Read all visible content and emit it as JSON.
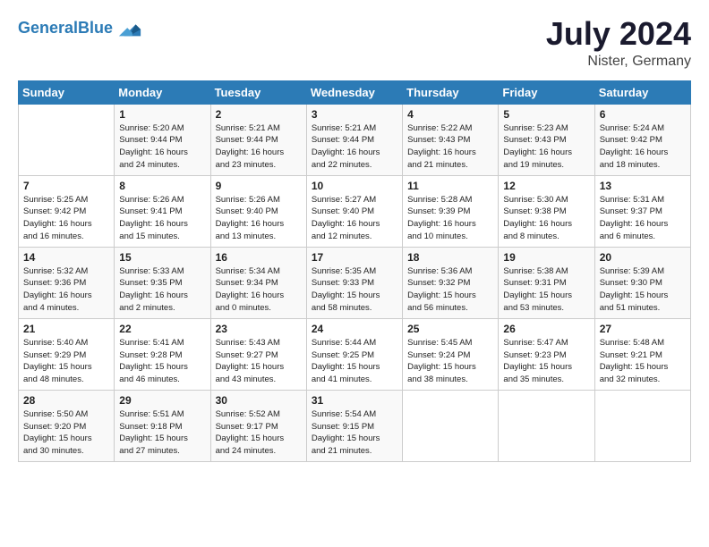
{
  "header": {
    "logo_line1": "General",
    "logo_line2": "Blue",
    "month": "July 2024",
    "location": "Nister, Germany"
  },
  "weekdays": [
    "Sunday",
    "Monday",
    "Tuesday",
    "Wednesday",
    "Thursday",
    "Friday",
    "Saturday"
  ],
  "weeks": [
    [
      {
        "day": "",
        "info": ""
      },
      {
        "day": "1",
        "info": "Sunrise: 5:20 AM\nSunset: 9:44 PM\nDaylight: 16 hours\nand 24 minutes."
      },
      {
        "day": "2",
        "info": "Sunrise: 5:21 AM\nSunset: 9:44 PM\nDaylight: 16 hours\nand 23 minutes."
      },
      {
        "day": "3",
        "info": "Sunrise: 5:21 AM\nSunset: 9:44 PM\nDaylight: 16 hours\nand 22 minutes."
      },
      {
        "day": "4",
        "info": "Sunrise: 5:22 AM\nSunset: 9:43 PM\nDaylight: 16 hours\nand 21 minutes."
      },
      {
        "day": "5",
        "info": "Sunrise: 5:23 AM\nSunset: 9:43 PM\nDaylight: 16 hours\nand 19 minutes."
      },
      {
        "day": "6",
        "info": "Sunrise: 5:24 AM\nSunset: 9:42 PM\nDaylight: 16 hours\nand 18 minutes."
      }
    ],
    [
      {
        "day": "7",
        "info": "Sunrise: 5:25 AM\nSunset: 9:42 PM\nDaylight: 16 hours\nand 16 minutes."
      },
      {
        "day": "8",
        "info": "Sunrise: 5:26 AM\nSunset: 9:41 PM\nDaylight: 16 hours\nand 15 minutes."
      },
      {
        "day": "9",
        "info": "Sunrise: 5:26 AM\nSunset: 9:40 PM\nDaylight: 16 hours\nand 13 minutes."
      },
      {
        "day": "10",
        "info": "Sunrise: 5:27 AM\nSunset: 9:40 PM\nDaylight: 16 hours\nand 12 minutes."
      },
      {
        "day": "11",
        "info": "Sunrise: 5:28 AM\nSunset: 9:39 PM\nDaylight: 16 hours\nand 10 minutes."
      },
      {
        "day": "12",
        "info": "Sunrise: 5:30 AM\nSunset: 9:38 PM\nDaylight: 16 hours\nand 8 minutes."
      },
      {
        "day": "13",
        "info": "Sunrise: 5:31 AM\nSunset: 9:37 PM\nDaylight: 16 hours\nand 6 minutes."
      }
    ],
    [
      {
        "day": "14",
        "info": "Sunrise: 5:32 AM\nSunset: 9:36 PM\nDaylight: 16 hours\nand 4 minutes."
      },
      {
        "day": "15",
        "info": "Sunrise: 5:33 AM\nSunset: 9:35 PM\nDaylight: 16 hours\nand 2 minutes."
      },
      {
        "day": "16",
        "info": "Sunrise: 5:34 AM\nSunset: 9:34 PM\nDaylight: 16 hours\nand 0 minutes."
      },
      {
        "day": "17",
        "info": "Sunrise: 5:35 AM\nSunset: 9:33 PM\nDaylight: 15 hours\nand 58 minutes."
      },
      {
        "day": "18",
        "info": "Sunrise: 5:36 AM\nSunset: 9:32 PM\nDaylight: 15 hours\nand 56 minutes."
      },
      {
        "day": "19",
        "info": "Sunrise: 5:38 AM\nSunset: 9:31 PM\nDaylight: 15 hours\nand 53 minutes."
      },
      {
        "day": "20",
        "info": "Sunrise: 5:39 AM\nSunset: 9:30 PM\nDaylight: 15 hours\nand 51 minutes."
      }
    ],
    [
      {
        "day": "21",
        "info": "Sunrise: 5:40 AM\nSunset: 9:29 PM\nDaylight: 15 hours\nand 48 minutes."
      },
      {
        "day": "22",
        "info": "Sunrise: 5:41 AM\nSunset: 9:28 PM\nDaylight: 15 hours\nand 46 minutes."
      },
      {
        "day": "23",
        "info": "Sunrise: 5:43 AM\nSunset: 9:27 PM\nDaylight: 15 hours\nand 43 minutes."
      },
      {
        "day": "24",
        "info": "Sunrise: 5:44 AM\nSunset: 9:25 PM\nDaylight: 15 hours\nand 41 minutes."
      },
      {
        "day": "25",
        "info": "Sunrise: 5:45 AM\nSunset: 9:24 PM\nDaylight: 15 hours\nand 38 minutes."
      },
      {
        "day": "26",
        "info": "Sunrise: 5:47 AM\nSunset: 9:23 PM\nDaylight: 15 hours\nand 35 minutes."
      },
      {
        "day": "27",
        "info": "Sunrise: 5:48 AM\nSunset: 9:21 PM\nDaylight: 15 hours\nand 32 minutes."
      }
    ],
    [
      {
        "day": "28",
        "info": "Sunrise: 5:50 AM\nSunset: 9:20 PM\nDaylight: 15 hours\nand 30 minutes."
      },
      {
        "day": "29",
        "info": "Sunrise: 5:51 AM\nSunset: 9:18 PM\nDaylight: 15 hours\nand 27 minutes."
      },
      {
        "day": "30",
        "info": "Sunrise: 5:52 AM\nSunset: 9:17 PM\nDaylight: 15 hours\nand 24 minutes."
      },
      {
        "day": "31",
        "info": "Sunrise: 5:54 AM\nSunset: 9:15 PM\nDaylight: 15 hours\nand 21 minutes."
      },
      {
        "day": "",
        "info": ""
      },
      {
        "day": "",
        "info": ""
      },
      {
        "day": "",
        "info": ""
      }
    ]
  ]
}
